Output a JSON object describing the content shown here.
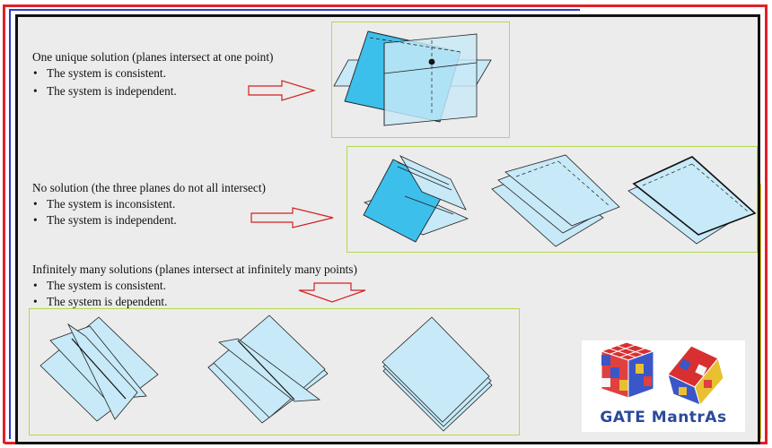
{
  "sections": [
    {
      "title": "One unique solution (planes intersect at one point)",
      "bullets": [
        "The system is consistent.",
        "The system is independent."
      ]
    },
    {
      "title": "No solution (the three planes do not all intersect)",
      "bullets": [
        "The system is inconsistent.",
        "The system is independent."
      ]
    },
    {
      "title": "Infinitely many solutions (planes intersect at infinitely many points)",
      "bullets": [
        "The system is consistent.",
        "The system is dependent."
      ]
    }
  ],
  "logo": {
    "text": "GATE MantrAs"
  },
  "colors": {
    "plane_dark": "#3cbfea",
    "plane_light": "#c8e9f7",
    "arrow": "#d42020",
    "figure_border": "#b4d84e",
    "frame_red": "#e0202a",
    "frame_blue": "#2a3bd0"
  }
}
